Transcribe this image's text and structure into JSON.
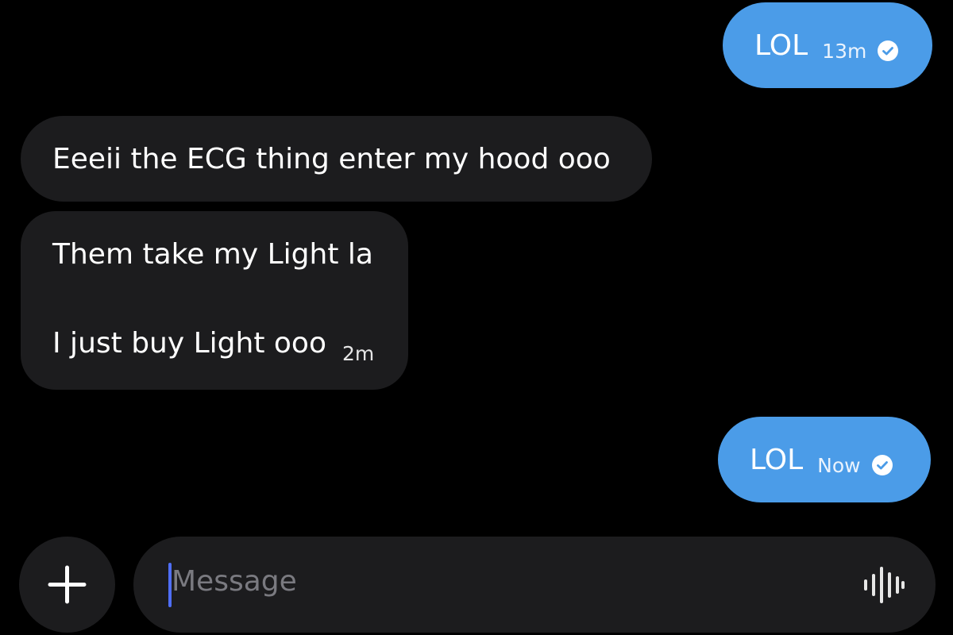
{
  "messages": [
    {
      "direction": "outgoing",
      "text": "LOL",
      "time": "13m",
      "status": "sent"
    },
    {
      "direction": "incoming",
      "text": "Eeeii the ECG thing enter my hood ooo"
    },
    {
      "direction": "incoming",
      "lines": [
        "Them take my Light la",
        "I just buy Light ooo"
      ],
      "time": "2m"
    },
    {
      "direction": "outgoing",
      "text": "LOL",
      "time": "Now",
      "status": "sent"
    }
  ],
  "composer": {
    "placeholder": "Message",
    "add_icon": "plus-icon",
    "voice_icon": "voice-waveform-icon"
  },
  "colors": {
    "background": "#000000",
    "outgoing_bubble": "#4b9ce8",
    "incoming_bubble": "#1c1c1e",
    "caret": "#4f6ef7"
  }
}
